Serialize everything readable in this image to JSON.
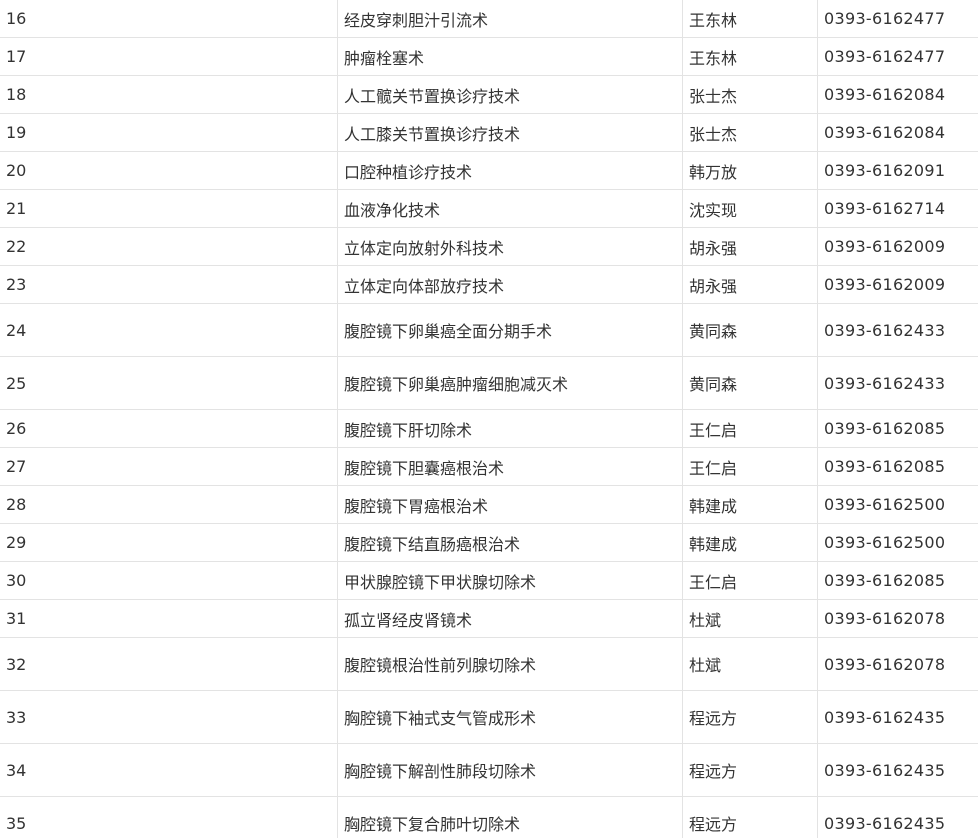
{
  "rows": [
    {
      "no": "16",
      "name": "经皮穿刺胆汁引流术",
      "person": "王东林",
      "phone": "0393-6162477"
    },
    {
      "no": "17",
      "name": "肿瘤栓塞术",
      "person": "王东林",
      "phone": "0393-6162477"
    },
    {
      "no": "18",
      "name": "人工髋关节置换诊疗技术",
      "person": "张士杰",
      "phone": "0393-6162084"
    },
    {
      "no": "19",
      "name": "人工膝关节置换诊疗技术",
      "person": "张士杰",
      "phone": "0393-6162084"
    },
    {
      "no": "20",
      "name": "口腔种植诊疗技术",
      "person": "韩万放",
      "phone": "0393-6162091"
    },
    {
      "no": "21",
      "name": "血液净化技术",
      "person": "沈实现",
      "phone": "0393-6162714"
    },
    {
      "no": "22",
      "name": "立体定向放射外科技术",
      "person": "胡永强",
      "phone": "0393-6162009"
    },
    {
      "no": "23",
      "name": "立体定向体部放疗技术",
      "person": "胡永强",
      "phone": "0393-6162009"
    },
    {
      "no": "24",
      "name": "腹腔镜下卵巢癌全面分期手术",
      "person": "黄同森",
      "phone": "0393-6162433"
    },
    {
      "no": "25",
      "name": "腹腔镜下卵巢癌肿瘤细胞减灭术",
      "person": "黄同森",
      "phone": "0393-6162433"
    },
    {
      "no": "26",
      "name": "腹腔镜下肝切除术",
      "person": "王仁启",
      "phone": "0393-6162085"
    },
    {
      "no": "27",
      "name": "腹腔镜下胆囊癌根治术",
      "person": "王仁启",
      "phone": "0393-6162085"
    },
    {
      "no": "28",
      "name": "腹腔镜下胃癌根治术",
      "person": "韩建成",
      "phone": "0393-6162500"
    },
    {
      "no": "29",
      "name": "腹腔镜下结直肠癌根治术",
      "person": "韩建成",
      "phone": "0393-6162500"
    },
    {
      "no": "30",
      "name": "甲状腺腔镜下甲状腺切除术",
      "person": "王仁启",
      "phone": "0393-6162085"
    },
    {
      "no": "31",
      "name": "孤立肾经皮肾镜术",
      "person": "杜斌",
      "phone": "0393-6162078"
    },
    {
      "no": "32",
      "name": "腹腔镜根治性前列腺切除术",
      "person": "杜斌",
      "phone": "0393-6162078"
    },
    {
      "no": "33",
      "name": "胸腔镜下袖式支气管成形术",
      "person": "程远方",
      "phone": "0393-6162435"
    },
    {
      "no": "34",
      "name": "胸腔镜下解剖性肺段切除术",
      "person": "程远方",
      "phone": "0393-6162435"
    },
    {
      "no": "35",
      "name": "胸腔镜下复合肺叶切除术",
      "person": "程远方",
      "phone": "0393-6162435"
    }
  ]
}
